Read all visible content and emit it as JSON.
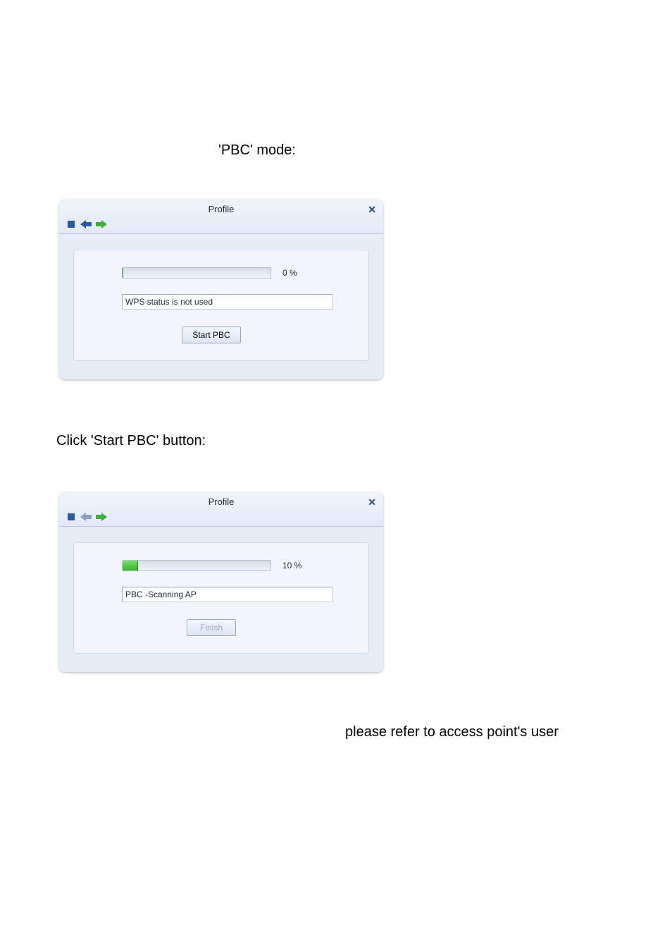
{
  "doc": {
    "mode_label": "'PBC' mode:",
    "instruction_click": "Click 'Start PBC' button:",
    "instruction_refer": "please refer to access point's user"
  },
  "window1": {
    "title": "Profile",
    "progress_percent_label": "0 %",
    "progress_fill_pct": 0,
    "status_text": "WPS status is not used",
    "button_label": "Start PBC",
    "button_enabled": true
  },
  "window2": {
    "title": "Profile",
    "progress_percent_label": "10 %",
    "progress_fill_pct": 10,
    "status_text": "PBC -Scanning AP",
    "button_label": "Finish",
    "button_enabled": false
  }
}
